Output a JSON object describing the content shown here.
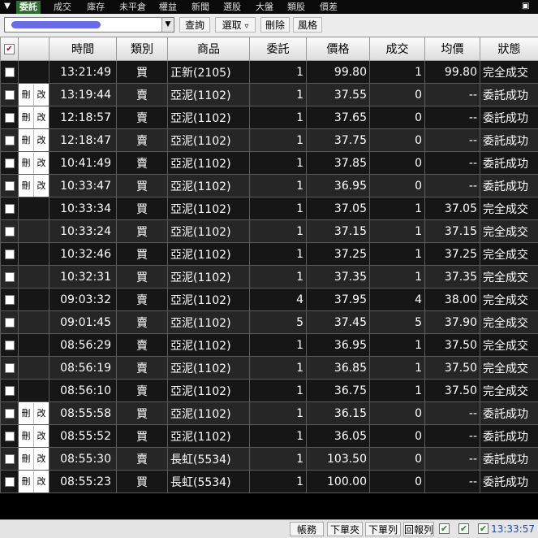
{
  "tabs": [
    "委託",
    "成交",
    "庫存",
    "未平倉",
    "權益",
    "新聞",
    "選股",
    "大盤",
    "類股",
    "價差"
  ],
  "active_tab": "委託",
  "toolbar": {
    "query_label": "查詢",
    "select_label": "選取",
    "delete_label": "刪除",
    "style_label": "風格"
  },
  "columns": [
    "時間",
    "類別",
    "商品",
    "委託",
    "價格",
    "成交",
    "均價",
    "狀態"
  ],
  "action_labels": {
    "delete": "刪",
    "modify": "改"
  },
  "colors": {
    "buy": "#ff2b2b",
    "sell": "#4aa3ff",
    "tab_active": "#2e6e2e"
  },
  "orders": [
    {
      "time": "13:21:49",
      "side": "買",
      "product": "正新(2105)",
      "qty": "1",
      "price": "99.80",
      "filled": "1",
      "avg": "99.80",
      "status": "完全成交",
      "editable": false
    },
    {
      "time": "13:19:44",
      "side": "賣",
      "product": "亞泥(1102)",
      "qty": "1",
      "price": "37.55",
      "filled": "0",
      "avg": "--",
      "status": "委託成功",
      "editable": true
    },
    {
      "time": "12:18:57",
      "side": "賣",
      "product": "亞泥(1102)",
      "qty": "1",
      "price": "37.65",
      "filled": "0",
      "avg": "--",
      "status": "委託成功",
      "editable": true
    },
    {
      "time": "12:18:47",
      "side": "賣",
      "product": "亞泥(1102)",
      "qty": "1",
      "price": "37.75",
      "filled": "0",
      "avg": "--",
      "status": "委託成功",
      "editable": true
    },
    {
      "time": "10:41:49",
      "side": "賣",
      "product": "亞泥(1102)",
      "qty": "1",
      "price": "37.85",
      "filled": "0",
      "avg": "--",
      "status": "委託成功",
      "editable": true
    },
    {
      "time": "10:33:47",
      "side": "買",
      "product": "亞泥(1102)",
      "qty": "1",
      "price": "36.95",
      "filled": "0",
      "avg": "--",
      "status": "委託成功",
      "editable": true
    },
    {
      "time": "10:33:34",
      "side": "買",
      "product": "亞泥(1102)",
      "qty": "1",
      "price": "37.05",
      "filled": "1",
      "avg": "37.05",
      "status": "完全成交",
      "editable": false
    },
    {
      "time": "10:33:24",
      "side": "買",
      "product": "亞泥(1102)",
      "qty": "1",
      "price": "37.15",
      "filled": "1",
      "avg": "37.15",
      "status": "完全成交",
      "editable": false
    },
    {
      "time": "10:32:46",
      "side": "買",
      "product": "亞泥(1102)",
      "qty": "1",
      "price": "37.25",
      "filled": "1",
      "avg": "37.25",
      "status": "完全成交",
      "editable": false
    },
    {
      "time": "10:32:31",
      "side": "買",
      "product": "亞泥(1102)",
      "qty": "1",
      "price": "37.35",
      "filled": "1",
      "avg": "37.35",
      "status": "完全成交",
      "editable": false
    },
    {
      "time": "09:03:32",
      "side": "賣",
      "product": "亞泥(1102)",
      "qty": "4",
      "price": "37.95",
      "filled": "4",
      "avg": "38.00",
      "status": "完全成交",
      "editable": false
    },
    {
      "time": "09:01:45",
      "side": "賣",
      "product": "亞泥(1102)",
      "qty": "5",
      "price": "37.45",
      "filled": "5",
      "avg": "37.90",
      "status": "完全成交",
      "editable": false
    },
    {
      "time": "08:56:29",
      "side": "賣",
      "product": "亞泥(1102)",
      "qty": "1",
      "price": "36.95",
      "filled": "1",
      "avg": "37.50",
      "status": "完全成交",
      "editable": false
    },
    {
      "time": "08:56:19",
      "side": "賣",
      "product": "亞泥(1102)",
      "qty": "1",
      "price": "36.85",
      "filled": "1",
      "avg": "37.50",
      "status": "完全成交",
      "editable": false
    },
    {
      "time": "08:56:10",
      "side": "賣",
      "product": "亞泥(1102)",
      "qty": "1",
      "price": "36.75",
      "filled": "1",
      "avg": "37.50",
      "status": "完全成交",
      "editable": false
    },
    {
      "time": "08:55:58",
      "side": "買",
      "product": "亞泥(1102)",
      "qty": "1",
      "price": "36.15",
      "filled": "0",
      "avg": "--",
      "status": "委託成功",
      "editable": true
    },
    {
      "time": "08:55:52",
      "side": "買",
      "product": "亞泥(1102)",
      "qty": "1",
      "price": "36.05",
      "filled": "0",
      "avg": "--",
      "status": "委託成功",
      "editable": true
    },
    {
      "time": "08:55:30",
      "side": "賣",
      "product": "長虹(5534)",
      "qty": "1",
      "price": "103.50",
      "filled": "0",
      "avg": "--",
      "status": "委託成功",
      "editable": true
    },
    {
      "time": "08:55:23",
      "side": "買",
      "product": "長虹(5534)",
      "qty": "1",
      "price": "100.00",
      "filled": "0",
      "avg": "--",
      "status": "委託成功",
      "editable": true
    }
  ],
  "statusbar": {
    "buttons": [
      "帳務",
      "下單夾",
      "下單列",
      "回報列"
    ],
    "checks": [
      true,
      true,
      true
    ],
    "clock": "13:33:57"
  }
}
